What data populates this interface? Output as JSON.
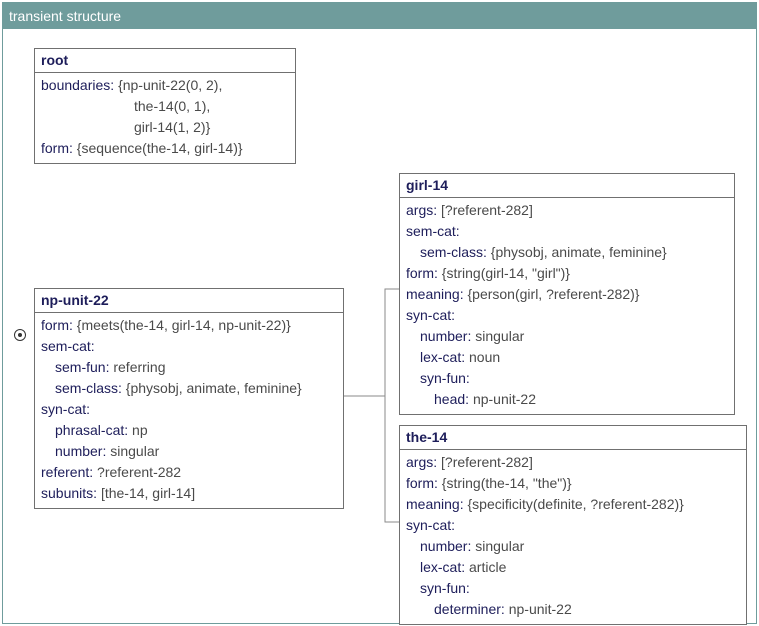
{
  "panel": {
    "title": "transient structure"
  },
  "root": {
    "name": "root",
    "boundaries_label": "boundaries:",
    "boundaries_lines": [
      "{np-unit-22(0, 2),",
      "the-14(0, 1),",
      "girl-14(1, 2)}"
    ],
    "form_label": "form:",
    "form_value": "{sequence(the-14, girl-14)}"
  },
  "np_unit": {
    "name": "np-unit-22",
    "form_label": "form:",
    "form_value": "{meets(the-14, girl-14, np-unit-22)}",
    "sem_cat_label": "sem-cat:",
    "sem_fun_label": "sem-fun:",
    "sem_fun_value": "referring",
    "sem_class_label": "sem-class:",
    "sem_class_value": "{physobj, animate, feminine}",
    "syn_cat_label": "syn-cat:",
    "phrasal_cat_label": "phrasal-cat:",
    "phrasal_cat_value": "np",
    "number_label": "number:",
    "number_value": "singular",
    "referent_label": "referent:",
    "referent_value": "?referent-282",
    "subunits_label": "subunits:",
    "subunits_value": "[the-14, girl-14]"
  },
  "girl": {
    "name": "girl-14",
    "args_label": "args:",
    "args_value": "[?referent-282]",
    "sem_cat_label": "sem-cat:",
    "sem_class_label": "sem-class:",
    "sem_class_value": "{physobj, animate, feminine}",
    "form_label": "form:",
    "form_value": "{string(girl-14, \"girl\")}",
    "meaning_label": "meaning:",
    "meaning_value": "{person(girl, ?referent-282)}",
    "syn_cat_label": "syn-cat:",
    "number_label": "number:",
    "number_value": "singular",
    "lex_cat_label": "lex-cat:",
    "lex_cat_value": "noun",
    "syn_fun_label": "syn-fun:",
    "head_label": "head:",
    "head_value": "np-unit-22"
  },
  "the": {
    "name": "the-14",
    "args_label": "args:",
    "args_value": "[?referent-282]",
    "form_label": "form:",
    "form_value": "{string(the-14, \"the\")}",
    "meaning_label": "meaning:",
    "meaning_value": "{specificity(definite, ?referent-282)}",
    "syn_cat_label": "syn-cat:",
    "number_label": "number:",
    "number_value": "singular",
    "lex_cat_label": "lex-cat:",
    "lex_cat_value": "article",
    "syn_fun_label": "syn-fun:",
    "determiner_label": "determiner:",
    "determiner_value": "np-unit-22"
  }
}
